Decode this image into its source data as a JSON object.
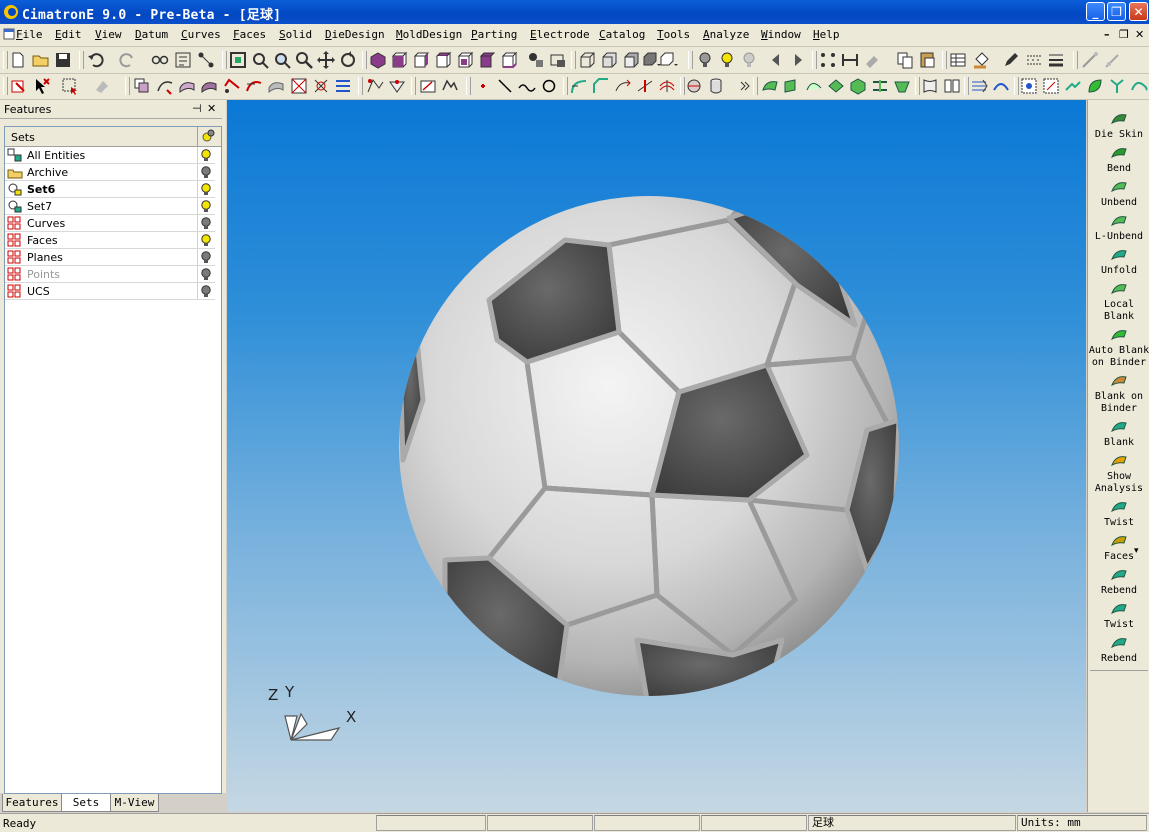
{
  "window": {
    "title": "CimatronE 9.0 - Pre-Beta - [足球]",
    "minimize": "_",
    "restore": "❐",
    "close": "✕"
  },
  "menu": {
    "items": [
      "File",
      "Edit",
      "View",
      "Datum",
      "Curves",
      "Faces",
      "Solid",
      "DieDesign",
      "MoldDesign",
      "Parting",
      "Electrode",
      "Catalog",
      "Tools",
      "Analyze",
      "Window",
      "Help"
    ]
  },
  "features_panel": {
    "title": "Features",
    "pin": "⊣",
    "close": "✕",
    "column_header": "Sets",
    "rows": [
      {
        "label": "All Entities",
        "bold": false,
        "dim": false,
        "bulb": "on"
      },
      {
        "label": "Archive",
        "bold": false,
        "dim": false,
        "bulb": "off"
      },
      {
        "label": "Set6",
        "bold": true,
        "dim": false,
        "bulb": "on"
      },
      {
        "label": "Set7",
        "bold": false,
        "dim": false,
        "bulb": "on"
      },
      {
        "label": "Curves",
        "bold": false,
        "dim": false,
        "bulb": "off"
      },
      {
        "label": "Faces",
        "bold": false,
        "dim": false,
        "bulb": "on"
      },
      {
        "label": "Planes",
        "bold": false,
        "dim": false,
        "bulb": "off"
      },
      {
        "label": "Points",
        "bold": false,
        "dim": true,
        "bulb": "off"
      },
      {
        "label": "UCS",
        "bold": false,
        "dim": false,
        "bulb": "off"
      }
    ]
  },
  "bottom_tabs": [
    "Features",
    "Sets",
    "M-View"
  ],
  "viewport": {
    "axis_labels": {
      "z": "Z",
      "y": "Y",
      "x": "X"
    },
    "colors": {
      "sky_top": "#0b78d6",
      "sky_bottom": "#c5d7e3",
      "panel_dark": "#4d4d4d",
      "panel_light": "#e0e0e0"
    }
  },
  "palette": {
    "items": [
      {
        "label": "Die Skin"
      },
      {
        "label": "Bend"
      },
      {
        "label": "Unbend"
      },
      {
        "label": "L-Unbend"
      },
      {
        "label": "Unfold"
      },
      {
        "label": "Local\nBlank"
      },
      {
        "label": "Auto Blank\non Binder"
      },
      {
        "label": "Blank on\nBinder"
      },
      {
        "label": "Blank"
      },
      {
        "label": "Show\nAnalysis"
      },
      {
        "label": "Twist"
      },
      {
        "label": "Faces"
      },
      {
        "label": "Rebend"
      },
      {
        "label": "Twist"
      },
      {
        "label": "Rebend"
      }
    ]
  },
  "status": {
    "state": "Ready",
    "file": "足球",
    "units": "Units: mm"
  }
}
